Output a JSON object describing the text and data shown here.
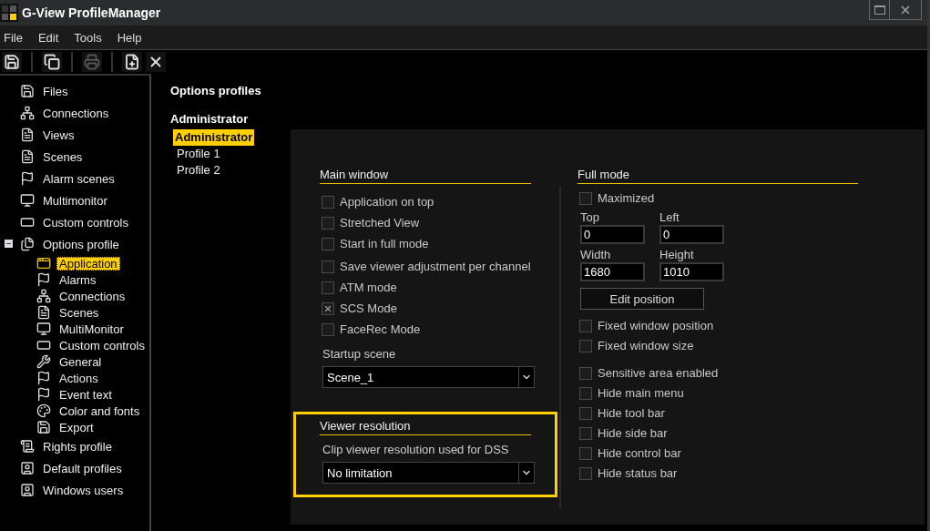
{
  "window": {
    "title": "G-View ProfileManager"
  },
  "menu": [
    "File",
    "Edit",
    "Tools",
    "Help"
  ],
  "toolbar": [
    {
      "disabled": false
    },
    {
      "disabled": false
    },
    {
      "disabled": true
    },
    {
      "disabled": false
    },
    {
      "disabled": false
    }
  ],
  "sidebar": {
    "items": [
      {
        "label": "Files"
      },
      {
        "label": "Connections"
      },
      {
        "label": "Views"
      },
      {
        "label": "Scenes"
      },
      {
        "label": "Alarm scenes"
      },
      {
        "label": "Multimonitor"
      },
      {
        "label": "Custom controls"
      },
      {
        "label": "Options profile",
        "expanded": true,
        "children": [
          {
            "label": "Application",
            "selected": true
          },
          {
            "label": "Alarms",
            "selected": false
          },
          {
            "label": "Connections",
            "selected": false
          },
          {
            "label": "Scenes",
            "selected": false
          },
          {
            "label": "MultiMonitor",
            "selected": false
          },
          {
            "label": "Custom controls",
            "selected": false
          },
          {
            "label": "General",
            "selected": false
          },
          {
            "label": "Actions",
            "selected": false
          },
          {
            "label": "Event text",
            "selected": false
          },
          {
            "label": "Color and fonts",
            "selected": false
          },
          {
            "label": "Export",
            "selected": false
          }
        ]
      },
      {
        "label": "Rights profile"
      },
      {
        "label": "Default profiles"
      },
      {
        "label": "Windows users"
      }
    ]
  },
  "profiles": {
    "title": "Options profiles",
    "current": "Administrator",
    "items": [
      {
        "label": "Administrator",
        "selected": true
      },
      {
        "label": "Profile 1",
        "selected": false
      },
      {
        "label": "Profile 2",
        "selected": false
      }
    ]
  },
  "main_window": {
    "title": "Main window",
    "options": [
      {
        "label": "Application on top",
        "checked": false
      },
      {
        "label": "Stretched View",
        "checked": false
      },
      {
        "label": "Start in full mode",
        "checked": false
      },
      {
        "label": "Save viewer adjustment per channel",
        "checked": false
      },
      {
        "label": "ATM mode",
        "checked": false
      },
      {
        "label": "SCS Mode",
        "checked": true
      },
      {
        "label": "FaceRec Mode",
        "checked": false
      }
    ],
    "startup_label": "Startup scene",
    "startup_value": "Scene_1"
  },
  "viewer_resolution": {
    "title": "Viewer resolution",
    "highlighted": true,
    "label": "Clip viewer resolution used for DSS",
    "value": "No limitation"
  },
  "full_mode": {
    "title": "Full mode",
    "maximized": {
      "label": "Maximized",
      "checked": false
    },
    "fields": [
      {
        "label": "Top",
        "value": "0"
      },
      {
        "label": "Left",
        "value": "0"
      },
      {
        "label": "Width",
        "value": "1680"
      },
      {
        "label": "Height",
        "value": "1010"
      }
    ],
    "button": "Edit position",
    "position_options": [
      {
        "label": "Fixed window position",
        "checked": false
      },
      {
        "label": "Fixed window size",
        "checked": false
      }
    ],
    "bar_options": [
      {
        "label": "Sensitive area enabled",
        "checked": false
      },
      {
        "label": "Hide main menu",
        "checked": false
      },
      {
        "label": "Hide tool bar",
        "checked": false
      },
      {
        "label": "Hide side bar",
        "checked": false
      },
      {
        "label": "Hide control bar",
        "checked": false
      },
      {
        "label": "Hide status bar",
        "checked": false
      }
    ]
  }
}
